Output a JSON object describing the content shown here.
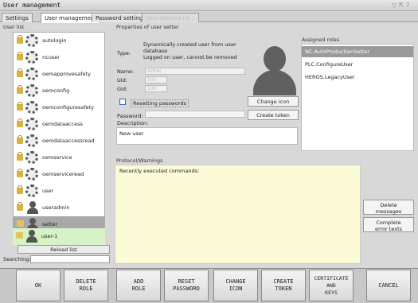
{
  "window": {
    "title": "User management",
    "controls": "▽ ⇱ ?"
  },
  "tabs": [
    {
      "label": "Settings"
    },
    {
      "label": "User management"
    },
    {
      "label": "Password settings"
    },
    {
      "label": "User-defined rol..."
    }
  ],
  "user_list": {
    "header": "User list",
    "users": [
      {
        "name": "autologin",
        "type": "function"
      },
      {
        "name": "ncuser",
        "type": "function"
      },
      {
        "name": "oemapprovesafety",
        "type": "function"
      },
      {
        "name": "oemconfig",
        "type": "function"
      },
      {
        "name": "oemconfiguresafety",
        "type": "function"
      },
      {
        "name": "oemdataaccess",
        "type": "function"
      },
      {
        "name": "oemdataaccessread",
        "type": "function"
      },
      {
        "name": "oemservice",
        "type": "function"
      },
      {
        "name": "oemserviceread",
        "type": "function"
      },
      {
        "name": "user",
        "type": "function"
      },
      {
        "name": "useradmin",
        "type": "person"
      },
      {
        "name": "setter",
        "type": "person"
      },
      {
        "name": "support",
        "type": "person"
      },
      {
        "name": "user-1",
        "type": "person"
      }
    ],
    "reload_label": "Reload list",
    "search_label": "Searching:"
  },
  "properties": {
    "header": "Properties of user setter",
    "type_label": "Type:",
    "type_value": "Dynamically created user from user database\nLogged on user, cannot be removed",
    "name_label": "Name:",
    "name_value": "setter",
    "uid_label": "Uid:",
    "uid_value": "505",
    "gid_label": "Gid:",
    "gid_value": "100",
    "resetting_passwords_label": "Resetting passwords",
    "password_label": "Password:",
    "description_label": "Description:",
    "description_value": "New user",
    "change_icon_label": "Change icon",
    "create_token_label": "Create token"
  },
  "assigned_roles": {
    "header": "Assigned roles",
    "roles": [
      "NC.AutoProductionSetter",
      "PLC.ConfigureUser",
      "HEROS.LegacyUser"
    ]
  },
  "protocol": {
    "header": "Protocol/Warnings",
    "text": "Recently executed commands:",
    "delete_messages_label": "Delete\nmessages",
    "complete_errors_label": "Complete\nerror texts"
  },
  "softkeys": [
    {
      "label": "OK"
    },
    {
      "label": "DELETE\nROLE"
    },
    {
      "label": "ADD\nROLE"
    },
    {
      "label": "RESET\nPASSWORD"
    },
    {
      "label": "CHANGE\nICON"
    },
    {
      "label": "CREATE\nTOKEN"
    },
    {
      "label": "CERTIFICATE\nAND\nKEYS"
    },
    {
      "label": "CANCEL"
    }
  ]
}
